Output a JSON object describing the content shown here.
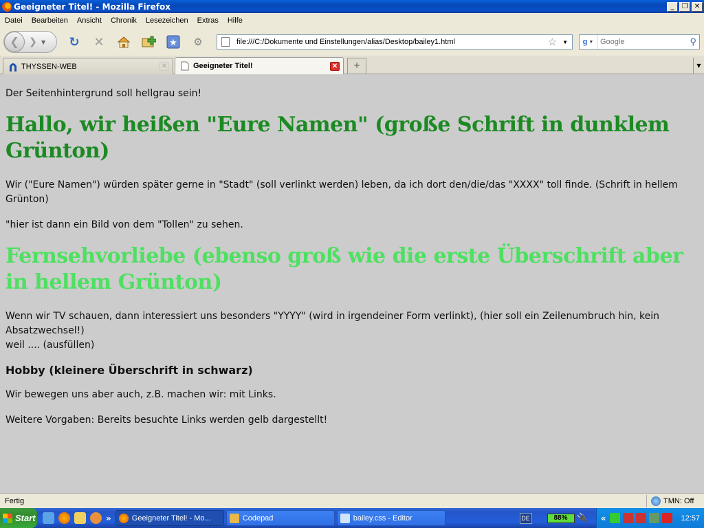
{
  "window": {
    "title": "Geeigneter Titel! - Mozilla Firefox"
  },
  "menu": [
    "Datei",
    "Bearbeiten",
    "Ansicht",
    "Chronik",
    "Lesezeichen",
    "Extras",
    "Hilfe"
  ],
  "nav": {
    "url": "file:///C:/Dokumente und Einstellungen/alias/Desktop/bailey1.html",
    "search_placeholder": "Google"
  },
  "tabs": [
    {
      "title": "THYSSEN-WEB"
    },
    {
      "title": "Geeigneter Titel!"
    }
  ],
  "content": {
    "p1": "Der Seitenhintergrund soll hellgrau sein!",
    "h1": "Hallo, wir heißen \"Eure Namen\" (große Schrift in dunklem Grünton)",
    "p2_pre": "Wir (\"Eure Namen\") würden später gerne in ",
    "p2_link": "\"Stadt\"",
    "p2_post": " (soll verlinkt werden) leben, da ich dort den/die/das \"XXXX\" toll finde. (Schrift in hellem Grünton)",
    "p3": "\"hier ist dann ein Bild von dem \"Tollen\" zu sehen.",
    "h2": "Fernsehvorliebe (ebenso groß wie die erste Überschrift aber in hellem Grünton)",
    "p4_line1": "Wenn wir TV schauen, dann interessiert uns besonders \"YYYY\" (wird in irgendeiner Form verlinkt), (hier soll ein Zeilenumbruch hin, kein Absatzwechsel!)",
    "p4_line2": "weil .... (ausfüllen)",
    "h3": "Hobby (kleinere Überschrift in schwarz)",
    "p5": "Wir bewegen uns aber auch, z.B. machen wir: mit Links.",
    "p6": "Weitere Vorgaben: Bereits besuchte Links werden gelb dargestellt!"
  },
  "status": {
    "text": "Fertig",
    "tmn": "TMN: Off"
  },
  "taskbar": {
    "start": "Start",
    "buttons": [
      "Geeigneter Titel! - Mo...",
      "Codepad",
      "bailey.css - Editor"
    ],
    "lang": "DE",
    "battery": "88%",
    "clock": "12:57"
  },
  "colors": {
    "page_bg": "#cccccc",
    "h1": "#1c8a23",
    "h2": "#4ee060"
  },
  "icons": [
    "firefox-icon",
    "back-icon",
    "forward-icon",
    "reload-icon",
    "stop-icon",
    "home-icon",
    "new-bookmark-icon",
    "bookmarks-icon",
    "addon-icon",
    "page-icon",
    "star-icon",
    "google-icon",
    "search-icon",
    "close-icon",
    "new-tab-icon"
  ]
}
